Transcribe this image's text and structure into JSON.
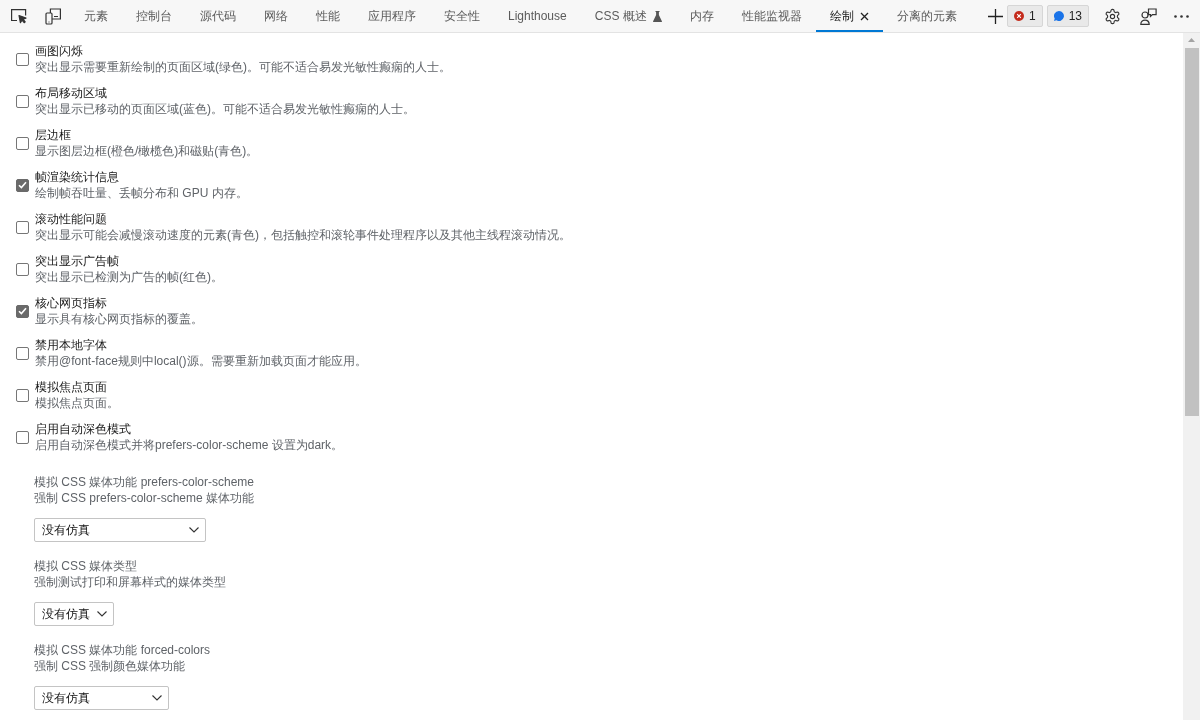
{
  "toolbar": {
    "tabs": [
      {
        "label": "元素",
        "selected": false,
        "experimental": false,
        "closable": false
      },
      {
        "label": "控制台",
        "selected": false,
        "experimental": false,
        "closable": false
      },
      {
        "label": "源代码",
        "selected": false,
        "experimental": false,
        "closable": false
      },
      {
        "label": "网络",
        "selected": false,
        "experimental": false,
        "closable": false
      },
      {
        "label": "性能",
        "selected": false,
        "experimental": false,
        "closable": false
      },
      {
        "label": "应用程序",
        "selected": false,
        "experimental": false,
        "closable": false
      },
      {
        "label": "安全性",
        "selected": false,
        "experimental": false,
        "closable": false
      },
      {
        "label": "Lighthouse",
        "selected": false,
        "experimental": false,
        "closable": false
      },
      {
        "label": "CSS 概述",
        "selected": false,
        "experimental": true,
        "closable": false
      },
      {
        "label": "内存",
        "selected": false,
        "experimental": false,
        "closable": false
      },
      {
        "label": "性能监视器",
        "selected": false,
        "experimental": false,
        "closable": false
      },
      {
        "label": "绘制",
        "selected": true,
        "experimental": false,
        "closable": true
      },
      {
        "label": "分离的元素",
        "selected": false,
        "experimental": false,
        "closable": false
      }
    ],
    "error_count": "1",
    "message_count": "13"
  },
  "rendering_options": [
    {
      "title": "画图闪烁",
      "description": "突出显示需要重新绘制的页面区域(绿色)。可能不适合易发光敏性癫痫的人士。",
      "checked": false
    },
    {
      "title": "布局移动区域",
      "description": "突出显示已移动的页面区域(蓝色)。可能不适合易发光敏性癫痫的人士。",
      "checked": false
    },
    {
      "title": "层边框",
      "description": "显示图层边框(橙色/橄榄色)和磁贴(青色)。",
      "checked": false
    },
    {
      "title": "帧渲染统计信息",
      "description": "绘制帧吞吐量、丢帧分布和 GPU 内存。",
      "checked": true
    },
    {
      "title": "滚动性能问题",
      "description": "突出显示可能会减慢滚动速度的元素(青色)，包括触控和滚轮事件处理程序以及其他主线程滚动情况。",
      "checked": false
    },
    {
      "title": "突出显示广告帧",
      "description": "突出显示已检测为广告的帧(红色)。",
      "checked": false
    },
    {
      "title": "核心网页指标",
      "description": "显示具有核心网页指标的覆盖。",
      "checked": true
    },
    {
      "title": "禁用本地字体",
      "description": "禁用@font-face规则中local()源。需要重新加载页面才能应用。",
      "checked": false
    },
    {
      "title": "模拟焦点页面",
      "description": "模拟焦点页面。",
      "checked": false
    },
    {
      "title": "启用自动深色模式",
      "description": "启用自动深色模式并将prefers-color-scheme 设置为dark。",
      "checked": false
    }
  ],
  "media_emulations": [
    {
      "title": "模拟 CSS 媒体功能 prefers-color-scheme",
      "description": "强制 CSS prefers-color-scheme 媒体功能",
      "value": "没有仿真"
    },
    {
      "title": "模拟 CSS 媒体类型",
      "description": "强制测试打印和屏幕样式的媒体类型",
      "value": "没有仿真"
    },
    {
      "title": "模拟 CSS 媒体功能 forced-colors",
      "description": "强制 CSS 强制颜色媒体功能",
      "value": "没有仿真"
    }
  ]
}
